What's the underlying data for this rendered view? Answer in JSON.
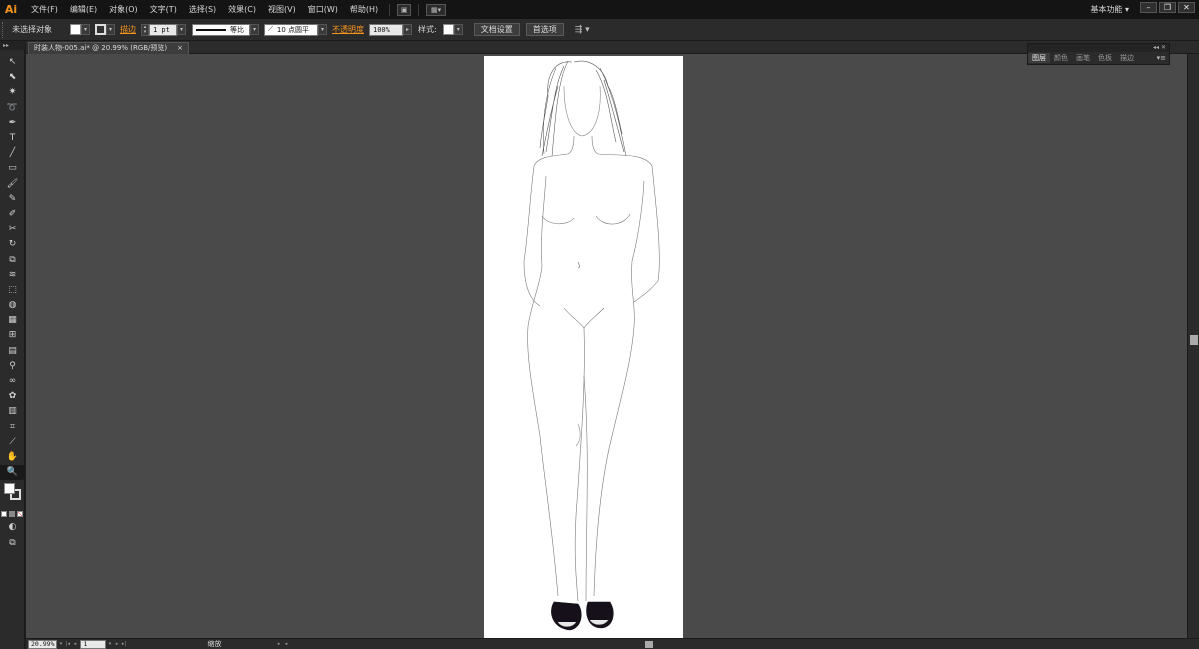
{
  "app": {
    "logo": "Ai",
    "menus": [
      "文件(F)",
      "编辑(E)",
      "对象(O)",
      "文字(T)",
      "选择(S)",
      "效果(C)",
      "视图(V)",
      "窗口(W)",
      "帮助(H)"
    ],
    "workspace": "基本功能",
    "window_buttons": [
      "–",
      "❐",
      "✕"
    ]
  },
  "control_bar": {
    "selection_status": "未选择对象",
    "stroke_link": "描边",
    "stroke_weight": "1 pt",
    "stroke_profile": "等比",
    "brush": "10 点圆平",
    "opacity_link": "不透明度",
    "opacity_value": "100%",
    "style_label": "样式:",
    "doc_setup_button": "文档设置",
    "preferences_button": "首选项"
  },
  "document": {
    "tab_title": "时装人物-005.ai* @ 20.99% (RGB/预览)",
    "tab_close": "×"
  },
  "panel": {
    "tabs": [
      "图层",
      "颜色",
      "画笔",
      "色板",
      "描边"
    ],
    "active_tab": 0,
    "header_icons": "◂◂ ✕"
  },
  "status_bar": {
    "zoom": "20.99%",
    "artboard_number": "1",
    "tool_label": "缩放"
  },
  "toolbox": {
    "header": "▸▸",
    "tools": [
      {
        "name": "selection-tool",
        "glyph": "↖"
      },
      {
        "name": "direct-selection-tool",
        "glyph": "⬉"
      },
      {
        "name": "magic-wand-tool",
        "glyph": "✷"
      },
      {
        "name": "lasso-tool",
        "glyph": "➰"
      },
      {
        "name": "pen-tool",
        "glyph": "✒"
      },
      {
        "name": "type-tool",
        "glyph": "T"
      },
      {
        "name": "line-tool",
        "glyph": "╱"
      },
      {
        "name": "rectangle-tool",
        "glyph": "▭"
      },
      {
        "name": "paintbrush-tool",
        "glyph": "🖌"
      },
      {
        "name": "pencil-tool",
        "glyph": "✎"
      },
      {
        "name": "blob-brush-tool",
        "glyph": "✐"
      },
      {
        "name": "eraser-tool",
        "glyph": "✂"
      },
      {
        "name": "rotate-tool",
        "glyph": "↻"
      },
      {
        "name": "scale-tool",
        "glyph": "⧉"
      },
      {
        "name": "warp-tool",
        "glyph": "≋"
      },
      {
        "name": "free-transform-tool",
        "glyph": "⬚"
      },
      {
        "name": "shape-builder-tool",
        "glyph": "◍"
      },
      {
        "name": "perspective-grid-tool",
        "glyph": "▦"
      },
      {
        "name": "mesh-tool",
        "glyph": "⊞"
      },
      {
        "name": "gradient-tool",
        "glyph": "▤"
      },
      {
        "name": "eyedropper-tool",
        "glyph": "⚲"
      },
      {
        "name": "blend-tool",
        "glyph": "∞"
      },
      {
        "name": "symbol-sprayer-tool",
        "glyph": "✿"
      },
      {
        "name": "column-graph-tool",
        "glyph": "▥"
      },
      {
        "name": "artboard-tool",
        "glyph": "⌗"
      },
      {
        "name": "slice-tool",
        "glyph": "⟋"
      },
      {
        "name": "hand-tool",
        "glyph": "✋"
      },
      {
        "name": "zoom-tool",
        "glyph": "🔍"
      }
    ]
  }
}
